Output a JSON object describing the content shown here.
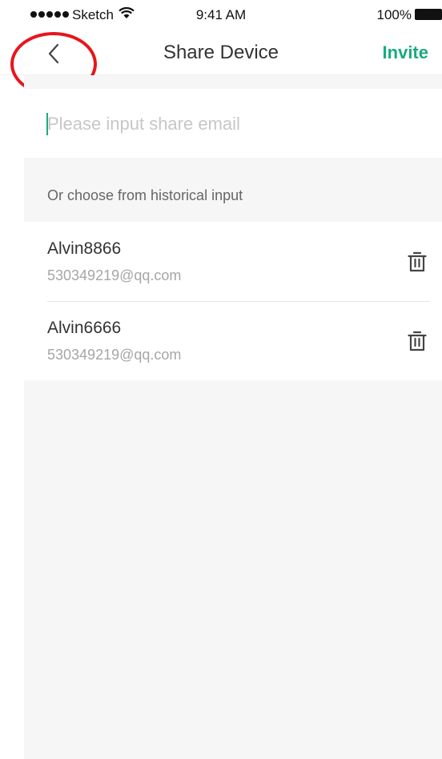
{
  "status_bar": {
    "carrier": "Sketch",
    "time": "9:41 AM",
    "battery_pct": "100%"
  },
  "nav": {
    "title": "Share Device",
    "invite_label": "Invite",
    "back_icon": "chevron-left-icon"
  },
  "email_input": {
    "value": "",
    "placeholder": "Please input share email"
  },
  "history": {
    "header": "Or choose from historical input",
    "items": [
      {
        "name": "Alvin8866",
        "email": "530349219@qq.com"
      },
      {
        "name": "Alvin6666",
        "email": "530349219@qq.com"
      }
    ],
    "delete_icon": "trash-icon"
  },
  "colors": {
    "accent": "#1aaa7e",
    "highlight": "#e8151b",
    "background": "#f6f6f6"
  }
}
